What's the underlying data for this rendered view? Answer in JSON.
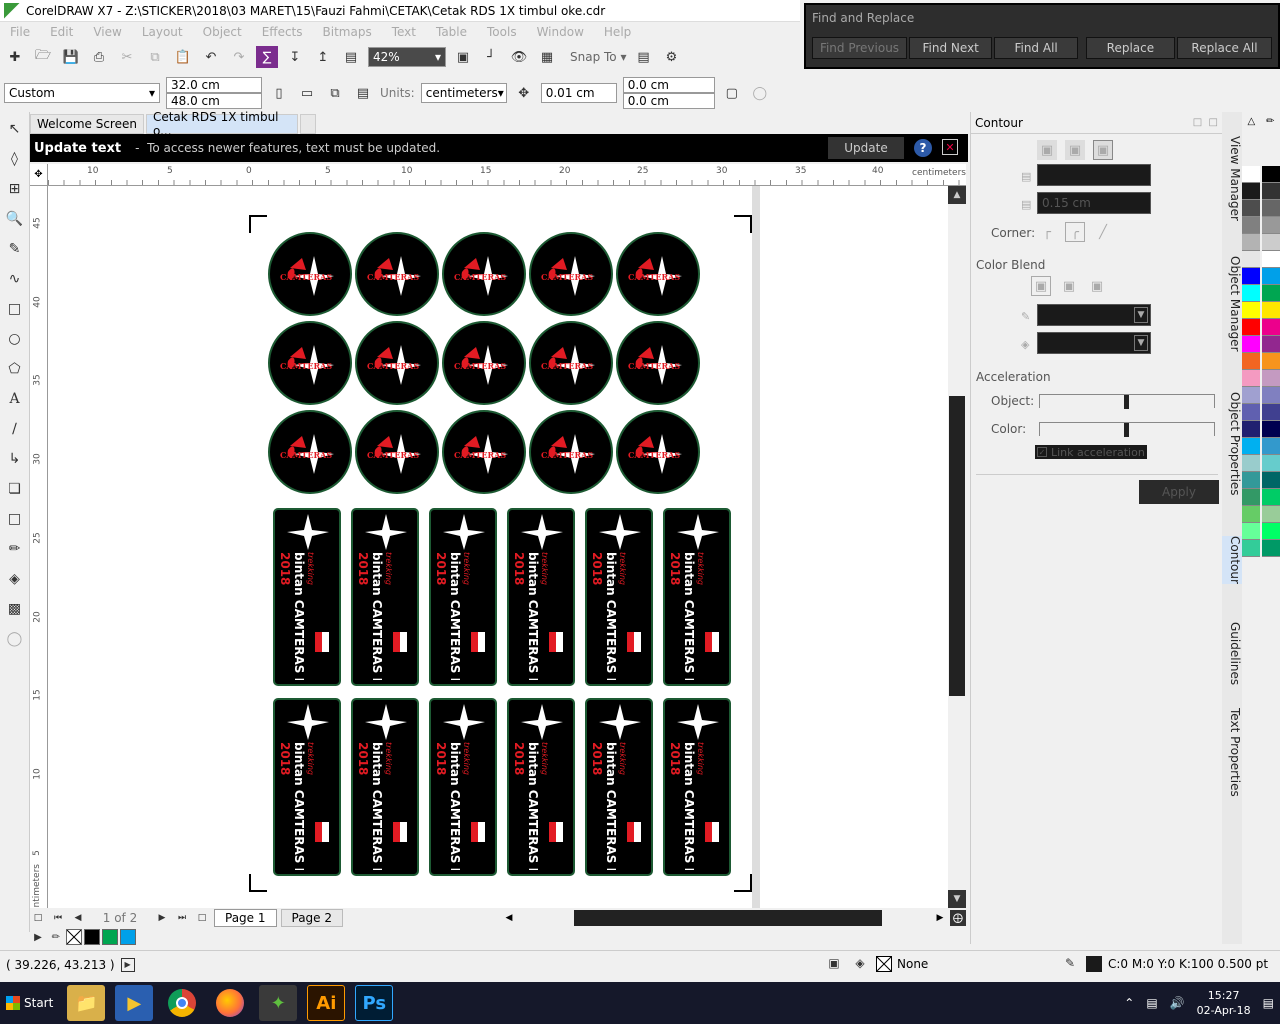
{
  "window": {
    "title": "CorelDRAW X7 - Z:\\STICKER\\2018\\03 MARET\\15\\Fauzi Fahmi\\CETAK\\Cetak RDS 1X timbul oke.cdr"
  },
  "menu": [
    "File",
    "Edit",
    "View",
    "Layout",
    "Object",
    "Effects",
    "Bitmaps",
    "Text",
    "Table",
    "Tools",
    "Window",
    "Help"
  ],
  "toolbar": {
    "zoom": "42%",
    "snap_to": "Snap To"
  },
  "propbar": {
    "preset": "Custom",
    "width": "32.0 cm",
    "height": "48.0 cm",
    "units_label": "Units:",
    "units": "centimeters",
    "nudge": "0.01 cm",
    "dup_x": "0.0 cm",
    "dup_y": "0.0 cm"
  },
  "doc_tabs": [
    "Welcome Screen",
    "Cetak RDS 1X timbul o..."
  ],
  "update_bar": {
    "title": "Update text",
    "message": "To access newer features, text must be updated.",
    "button": "Update"
  },
  "ruler": {
    "h_ticks": [
      "10",
      "5",
      "0",
      "5",
      "10",
      "15",
      "20",
      "25",
      "30",
      "35",
      "40"
    ],
    "unit": "centimeters",
    "v_ticks": [
      "45",
      "40",
      "35",
      "30",
      "25",
      "20",
      "15",
      "10",
      "5"
    ],
    "v_unit": "centimeters"
  },
  "pages": {
    "counter": "1 of 2",
    "tabs": [
      "Page 1",
      "Page 2"
    ]
  },
  "find_replace": {
    "title": "Find and Replace",
    "buttons": [
      "Find Previous",
      "Find Next",
      "Find All",
      "Replace",
      "Replace All"
    ]
  },
  "contour": {
    "title": "Contour",
    "offset": "0.15 cm",
    "corner_label": "Corner:",
    "color_blend_label": "Color Blend",
    "acceleration_label": "Acceleration",
    "object_label": "Object:",
    "color_label": "Color:",
    "link_label": "Link acceleration",
    "apply": "Apply"
  },
  "dockers": [
    "View Manager",
    "Object Manager",
    "Object Properties",
    "Contour",
    "Guidelines",
    "Text Properties"
  ],
  "status": {
    "coords": "( 39.226, 43.213 )",
    "fill_none": "None",
    "outline": "C:0 M:0 Y:0 K:100  0.500 pt"
  },
  "taskbar": {
    "start": "Start",
    "ai": "Ai",
    "ps": "Ps",
    "time": "15:27",
    "date": "02-Apr-18"
  },
  "sticker": {
    "circle_text": "CAMTERAS",
    "rect_text_1": "trekking",
    "rect_text_2": "bintan CAMTERAS IV",
    "rect_year": "2018"
  },
  "colors": {
    "accent": "#1d5a33",
    "red": "#e21b23"
  },
  "palette": [
    "#ffffff",
    "#000000",
    "#1a1a1a",
    "#333333",
    "#4d4d4d",
    "#666666",
    "#808080",
    "#999999",
    "#b3b3b3",
    "#cccccc",
    "#e6e6e6",
    "#ffffff",
    "#0000ff",
    "#00a0e9",
    "#00ffff",
    "#00a651",
    "#ffff00",
    "#ffe600",
    "#ff0000",
    "#ec008c",
    "#ff00ff",
    "#92278f",
    "#f26522",
    "#f7941d",
    "#f49ac1",
    "#c49ac1",
    "#a0a0d0",
    "#8080c0",
    "#6060b0",
    "#404090",
    "#202070",
    "#000050",
    "#00b0f0",
    "#3399cc",
    "#99cccc",
    "#66cccc",
    "#339999",
    "#006666",
    "#339966",
    "#00cc66",
    "#66cc66",
    "#99cc99",
    "#66ff99",
    "#00ff66",
    "#33cc99",
    "#009966"
  ],
  "doc_palette": [
    "#000000",
    "#00a651",
    "#00a0e9"
  ]
}
